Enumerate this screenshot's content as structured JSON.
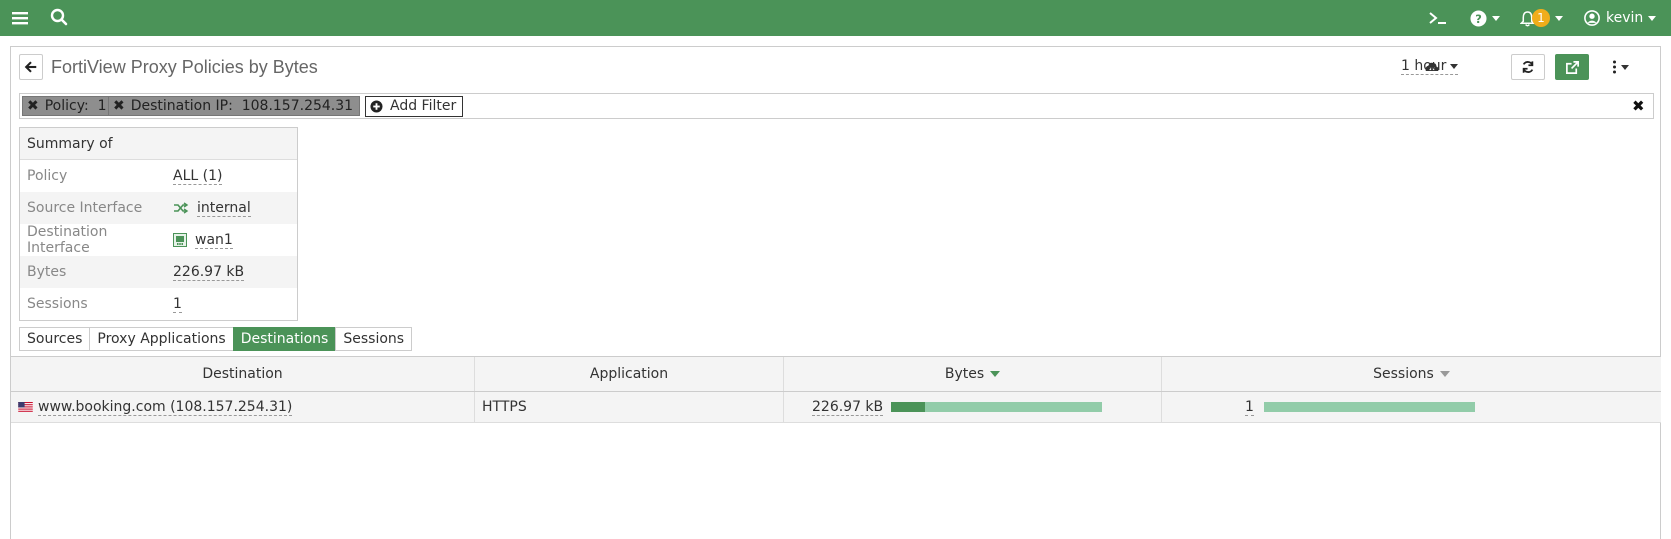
{
  "topbar": {
    "user": "kevin",
    "notification_count": "1",
    "icons": [
      "menu-icon",
      "search-icon",
      "cli-console-icon",
      "help-icon",
      "bell-icon",
      "user-icon"
    ]
  },
  "page": {
    "title": "FortiView Proxy Policies by Bytes",
    "time_range": "1 hour"
  },
  "filters": {
    "chips": [
      {
        "key": "Policy:",
        "value": "1"
      },
      {
        "key": "Destination IP:",
        "value": "108.157.254.31"
      }
    ],
    "add_label": "Add Filter"
  },
  "summary": {
    "title": "Summary of",
    "rows": [
      {
        "label": "Policy",
        "value": "ALL (1)"
      },
      {
        "label": "Source Interface",
        "value": "internal"
      },
      {
        "label": "Destination Interface",
        "value": "wan1"
      },
      {
        "label": "Bytes",
        "value": "226.97 kB"
      },
      {
        "label": "Sessions",
        "value": "1"
      }
    ]
  },
  "tabs": [
    "Sources",
    "Proxy Applications",
    "Destinations",
    "Sessions"
  ],
  "active_tab": "Destinations",
  "table": {
    "columns": [
      "Destination",
      "Application",
      "Bytes",
      "Sessions"
    ],
    "rows": [
      {
        "destination": "www.booking.com (108.157.254.31)",
        "application": "HTTPS",
        "bytes": "226.97 kB",
        "bytes_bar_fraction": 1.0,
        "bytes_dark_fraction": 0.16,
        "sessions": "1",
        "sessions_bar_fraction": 1.0
      }
    ]
  },
  "colors": {
    "brand_green": "#4b9358",
    "bar_light": "#92cca9",
    "badge": "#f0ad1b"
  }
}
